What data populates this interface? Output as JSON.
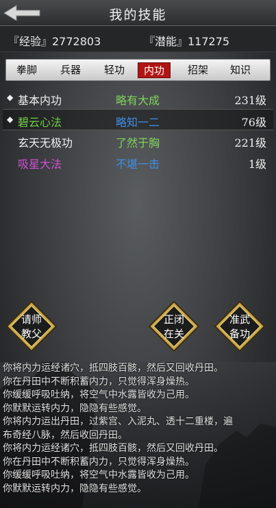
{
  "header": {
    "title": "我的技能",
    "back_icon": "back-arrow-icon"
  },
  "stats": {
    "exp": "『经验』2772803",
    "potential": "『潜能』117275"
  },
  "tabs": [
    {
      "label": "拳脚",
      "active": false
    },
    {
      "label": "兵器",
      "active": false
    },
    {
      "label": "轻功",
      "active": false
    },
    {
      "label": "内功",
      "active": true
    },
    {
      "label": "招架",
      "active": false
    },
    {
      "label": "知识",
      "active": false
    }
  ],
  "skills": [
    {
      "marker": "◆",
      "name": "基本内功",
      "rank": "略有大成",
      "level": "231级",
      "name_color": "#f0f0f0",
      "rank_color": "#7fd35a",
      "selected": false
    },
    {
      "marker": "◆",
      "name": "碧云心法",
      "rank": "略知一二",
      "level": "76级",
      "name_color": "#6fd04a",
      "rank_color": "#3f8fe6",
      "selected": true
    },
    {
      "marker": "",
      "name": "玄天无极功",
      "rank": "了然于胸",
      "level": "221级",
      "name_color": "#f0f0f0",
      "rank_color": "#7fd35a",
      "selected": false
    },
    {
      "marker": "",
      "name": "吸星大法",
      "rank": "不堪一击",
      "level": "1级",
      "name_color": "#d14fd6",
      "rank_color": "#3f8fe6",
      "selected": false
    }
  ],
  "actions": {
    "teacher": {
      "line1": "请师",
      "line2": "教父"
    },
    "retreat": {
      "line1": "正闭",
      "line2": "在关"
    },
    "prepare": {
      "line1": "准武",
      "line2": "备功"
    }
  },
  "log": [
    "你将内力运经诸穴，抵四肢百骸，然后又回收丹田。",
    "你在丹田中不断积蓄内力，只觉得浑身燥热。",
    "你缓缓呼吸吐纳，将空气中水露皆收为己用。",
    "你默默运转内力，隐隐有些感觉。",
    "你将内力运出丹田，过紫宫、入泥丸、透十二重楼，遍",
    "布奇经八脉，然后收回丹田。",
    "你将内力运经诸穴，抵四肢百骸，然后又回收丹田。",
    "你在丹田中不断积蓄内力，只觉得浑身燥热。",
    "你缓缓呼吸吐纳，将空气中水露皆收为己用。",
    "你默默运转内力，隐隐有些感觉。"
  ],
  "colors": {
    "active_tab": "#b01515",
    "button_gold": "#c9a64a"
  }
}
